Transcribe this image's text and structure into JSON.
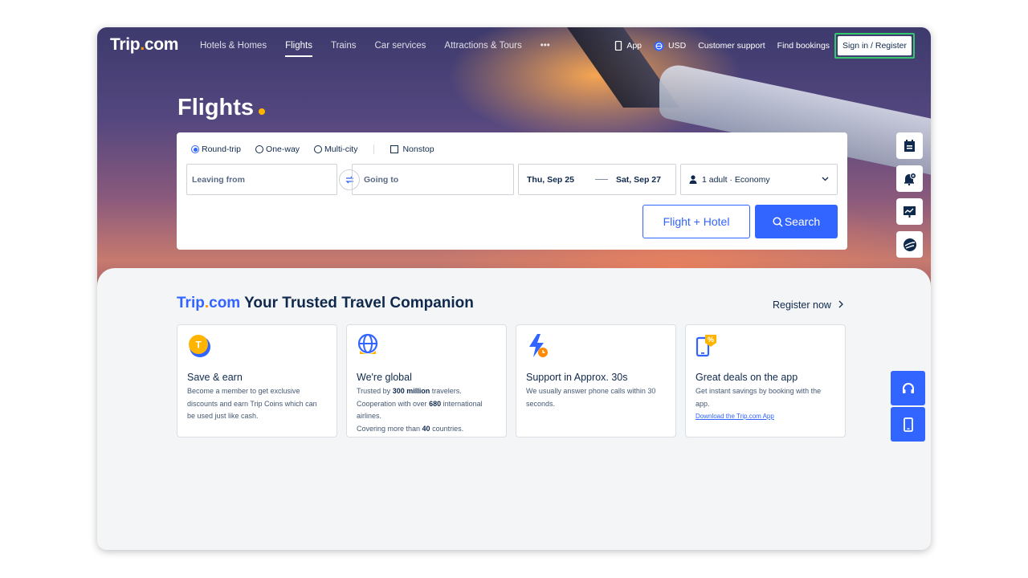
{
  "brand": {
    "name_part1": "Trip",
    "name_dot": ".",
    "name_part2": "com"
  },
  "nav": {
    "items": [
      "Hotels & Homes",
      "Flights",
      "Trains",
      "Car services",
      "Attractions & Tours",
      "•••"
    ],
    "active": "Flights",
    "right": {
      "app": "App",
      "currency": "USD",
      "support": "Customer support",
      "bookings": "Find bookings",
      "signin": "Sign in / Register"
    }
  },
  "hero": {
    "title": "Flights"
  },
  "search": {
    "trip_types": [
      "Round-trip",
      "One-way",
      "Multi-city"
    ],
    "selected_trip_type": "Round-trip",
    "nonstop_label": "Nonstop",
    "leaving_placeholder": "Leaving from",
    "going_placeholder": "Going to",
    "depart_date": "Thu, Sep 25",
    "return_date": "Sat, Sep 27",
    "passengers": "1 adult · Economy",
    "flight_hotel_label": "Flight + Hotel",
    "search_label": "Search"
  },
  "side_tools": [
    "calendar-icon",
    "price-alert-icon",
    "trend-chart-icon",
    "flight-globe-icon"
  ],
  "companion": {
    "title_brand_part1": "Trip",
    "title_brand_dot": ".",
    "title_brand_part2": "com",
    "title_rest": " Your Trusted Travel Companion",
    "register_label": "Register now",
    "cards": [
      {
        "icon": "coin-icon",
        "title": "Save & earn",
        "text": "Become a member to get exclusive discounts and earn Trip Coins which can be used just like cash."
      },
      {
        "icon": "globe-icon",
        "title": "We're global",
        "line1_pre": "Trusted by ",
        "line1_bold": "300 million",
        "line1_post": " travelers.",
        "line2_pre": "Cooperation with over ",
        "line2_bold": "680",
        "line2_post": " international airlines.",
        "line3_pre": "Covering more than ",
        "line3_bold": "40",
        "line3_post": " countries."
      },
      {
        "icon": "lightning-icon",
        "title": "Support in Approx. 30s",
        "text": "We usually answer phone calls within 30 seconds."
      },
      {
        "icon": "phone-deal-icon",
        "title": "Great deals on the app",
        "text": "Get instant savings by booking with the app.",
        "link": "Download the Trip.com App"
      }
    ]
  },
  "floating": [
    "headset-icon",
    "mobile-icon"
  ],
  "colors": {
    "accent": "#3264ff",
    "brand_dot": "#ff9500",
    "highlight": "#35c76b",
    "text_dark": "#0f294d"
  }
}
